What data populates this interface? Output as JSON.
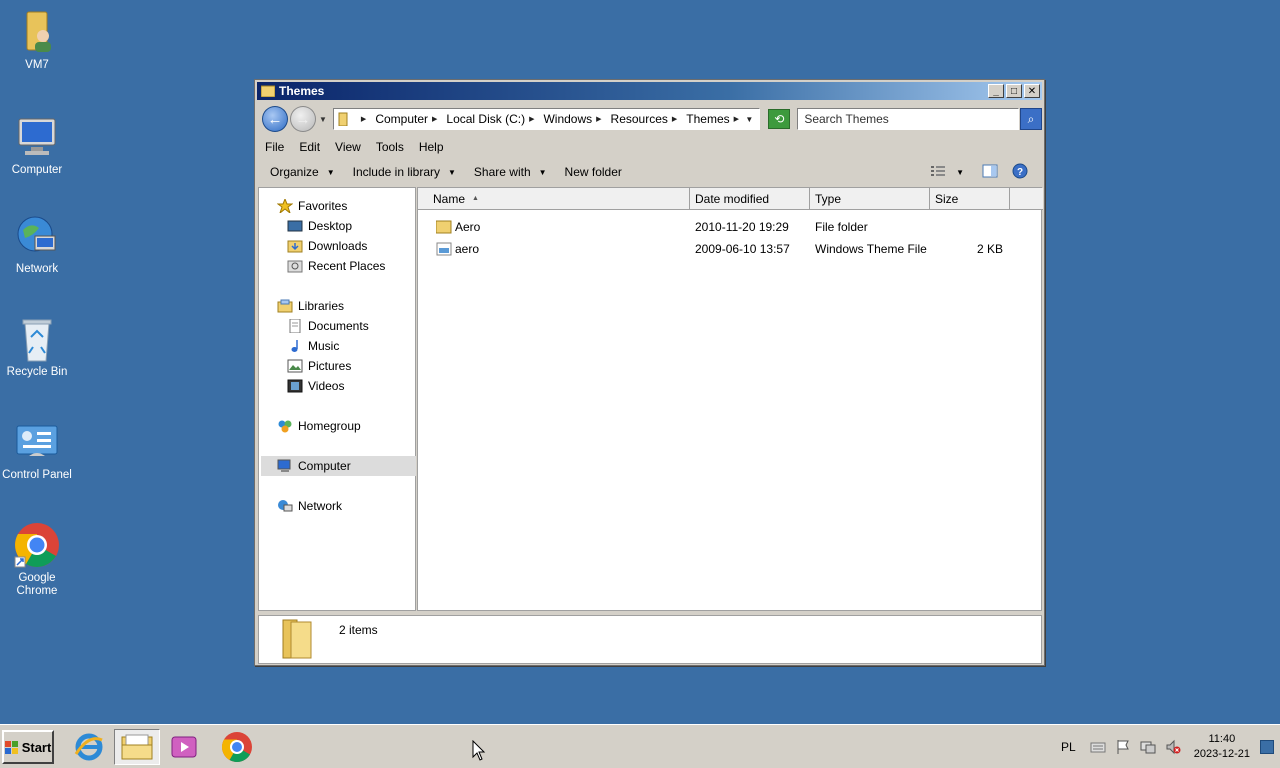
{
  "desktop": {
    "icons": [
      {
        "label": "VM7",
        "icon": "user-folder-icon"
      },
      {
        "label": "Computer",
        "icon": "computer-icon"
      },
      {
        "label": "Network",
        "icon": "network-globe-icon"
      },
      {
        "label": "Recycle Bin",
        "icon": "recycle-bin-icon"
      },
      {
        "label": "Control Panel",
        "icon": "control-panel-icon"
      },
      {
        "label": "Google Chrome",
        "icon": "chrome-icon"
      }
    ]
  },
  "window": {
    "title": "Themes",
    "controls": {
      "minimize": "_",
      "maximize": "□",
      "close": "✕"
    },
    "breadcrumb": [
      "Computer",
      "Local Disk (C:)",
      "Windows",
      "Resources",
      "Themes"
    ],
    "search_placeholder": "Search Themes",
    "menu": [
      "File",
      "Edit",
      "View",
      "Tools",
      "Help"
    ],
    "toolbar": {
      "organize": "Organize",
      "include": "Include in library",
      "share": "Share with",
      "new_folder": "New folder"
    },
    "nav": {
      "favorites": {
        "label": "Favorites",
        "items": [
          "Desktop",
          "Downloads",
          "Recent Places"
        ]
      },
      "libraries": {
        "label": "Libraries",
        "items": [
          "Documents",
          "Music",
          "Pictures",
          "Videos"
        ]
      },
      "homegroup": "Homegroup",
      "computer": "Computer",
      "network": "Network"
    },
    "columns": {
      "name": "Name",
      "date": "Date modified",
      "type": "Type",
      "size": "Size"
    },
    "files": [
      {
        "name": "Aero",
        "date": "2010-11-20 19:29",
        "type": "File folder",
        "size": "",
        "icon": "folder-icon"
      },
      {
        "name": "aero",
        "date": "2009-06-10 13:57",
        "type": "Windows Theme File",
        "size": "2 KB",
        "icon": "theme-file-icon"
      }
    ],
    "status": "2 items"
  },
  "taskbar": {
    "start": "Start",
    "apps": [
      "internet-explorer-icon",
      "file-explorer-icon",
      "media-player-icon",
      "chrome-icon"
    ],
    "language": "PL",
    "time": "11:40",
    "date": "2023-12-21"
  },
  "colors": {
    "desktop": "#3a6ea5",
    "title_gradient_start": "#0a246a",
    "chrome_face": "#d4d0c8"
  }
}
